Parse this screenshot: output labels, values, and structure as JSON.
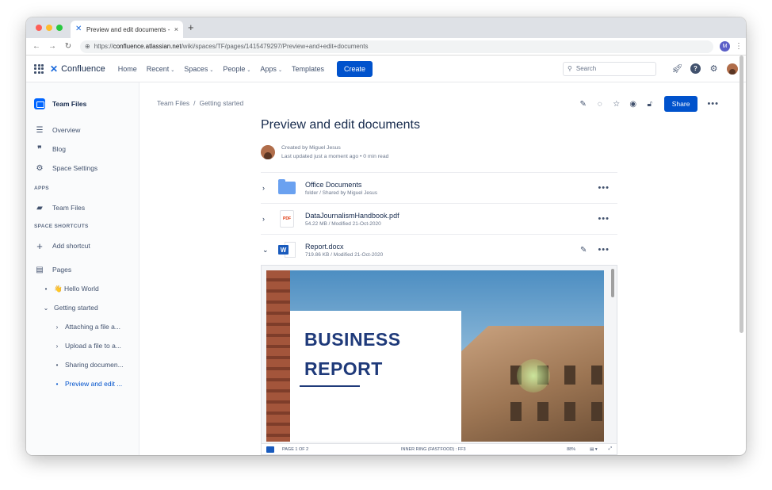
{
  "browser": {
    "tab_title": "Preview and edit documents -",
    "tab_close": "×",
    "new_tab": "+",
    "url_prefix": "https://",
    "url_host": "confluence.atlassian.net",
    "url_path": "/wiki/spaces/TF/pages/1415479297/Preview+and+edit+documents",
    "profile_initial": "M"
  },
  "topnav": {
    "brand": "Confluence",
    "items": [
      {
        "label": "Home"
      },
      {
        "label": "Recent"
      },
      {
        "label": "Spaces"
      },
      {
        "label": "People"
      },
      {
        "label": "Apps"
      },
      {
        "label": "Templates"
      }
    ],
    "create_label": "Create",
    "search_placeholder": "Search"
  },
  "sidebar": {
    "space_name": "Team Files",
    "items": [
      {
        "label": "Overview",
        "icon": "overview-icon"
      },
      {
        "label": "Blog",
        "icon": "quote-icon"
      },
      {
        "label": "Space Settings",
        "icon": "gear-icon"
      }
    ],
    "apps_heading": "APPS",
    "apps": [
      {
        "label": "Team Files"
      }
    ],
    "shortcuts_heading": "SPACE SHORTCUTS",
    "add_shortcut": "Add shortcut",
    "pages_label": "Pages",
    "tree": [
      {
        "label": "👋 Hello World"
      },
      {
        "label": "Getting started"
      },
      {
        "label": "Attaching a file a..."
      },
      {
        "label": "Upload a file to a..."
      },
      {
        "label": "Sharing documen..."
      },
      {
        "label": "Preview and edit ..."
      }
    ]
  },
  "page": {
    "breadcrumb": [
      "Team Files",
      "Getting started"
    ],
    "breadcrumb_sep": "/",
    "share_label": "Share",
    "title": "Preview and edit documents",
    "created_by": "Created by Miguel Jesus",
    "last_updated": "Last updated just a moment ago  •  0 min read"
  },
  "files": [
    {
      "name": "Office Documents",
      "meta": "folder / Shared by Miguel Jesus",
      "type": "folder"
    },
    {
      "name": "DataJournalismHandbook.pdf",
      "meta": "54.22 MB / Modified 21-Oct-2020",
      "type": "pdf",
      "thumb_label": "PDF"
    },
    {
      "name": "Report.docx",
      "meta": "719.86 KB / Modified 21-Oct-2020",
      "type": "docx",
      "thumb_label": "W"
    }
  ],
  "preview": {
    "report_line1": "BUSINESS",
    "report_line2": "REPORT",
    "status_page": "PAGE 1 OF 2",
    "status_center": "INNER RING (FASTFOOD) : FF3",
    "status_zoom": "88%"
  }
}
